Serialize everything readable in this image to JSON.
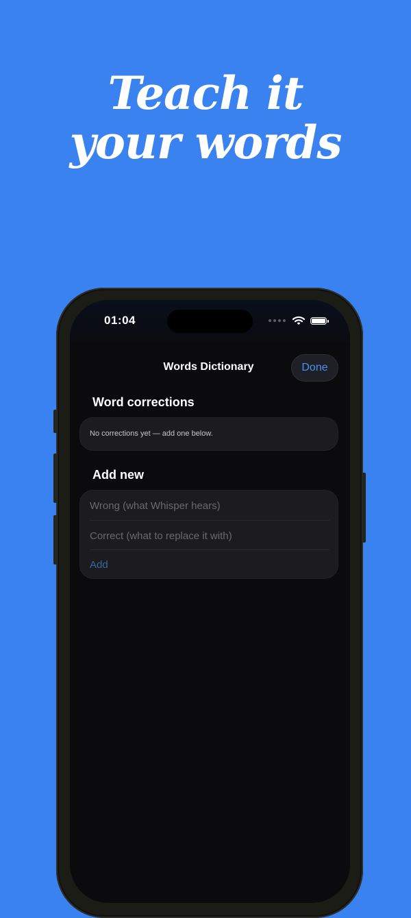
{
  "headline": {
    "line1": "Teach it",
    "line2": "your words"
  },
  "status_bar": {
    "time": "01:04",
    "icons": [
      "cellular-dots-icon",
      "wifi-icon",
      "battery-icon"
    ]
  },
  "nav": {
    "title": "Words Dictionary",
    "done_label": "Done"
  },
  "corrections": {
    "header": "Word corrections",
    "empty_message": "No corrections yet — add one below."
  },
  "add_new": {
    "header": "Add new",
    "wrong_placeholder": "Wrong (what Whisper hears)",
    "correct_placeholder": "Correct (what to replace it with)",
    "add_label": "Add"
  },
  "colors": {
    "background": "#3a82ef",
    "screen": "#0b0b0d",
    "card": "#1c1c1e",
    "accent": "#4a90f0",
    "accent_disabled": "#3569a8"
  }
}
